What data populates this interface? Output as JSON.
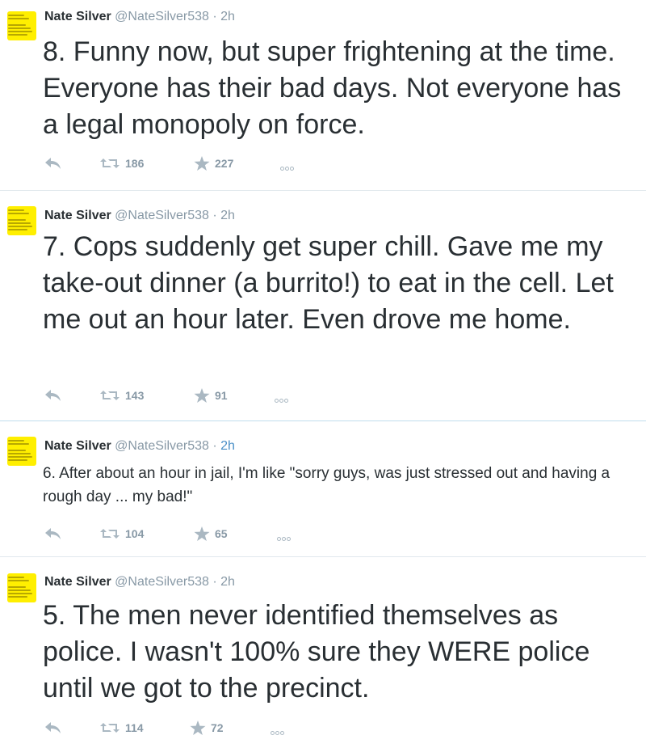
{
  "tweets": [
    {
      "name": "Nate Silver",
      "handle": "@NateSilver538",
      "sep": " · ",
      "time": "2h",
      "text": "8. Funny now, but super frightening at the time. Everyone has their bad days. Not everyone has a legal monopoly on force.",
      "retweets": "186",
      "favorites": "227"
    },
    {
      "name": "Nate Silver",
      "handle": "@NateSilver538",
      "sep": " · ",
      "time": "2h",
      "text": "7. Cops suddenly get super chill. Gave me my take-out dinner (a burrito!) to eat in the cell. Let me out an hour later. Even drove me home.",
      "retweets": "143",
      "favorites": "91"
    },
    {
      "name": "Nate Silver",
      "handle": "@NateSilver538",
      "sep": " · ",
      "time": "2h",
      "text": "6. After about an hour in jail, I'm like \"sorry guys, was just stressed out and having a rough day ... my bad!\"",
      "retweets": "104",
      "favorites": "65"
    },
    {
      "name": "Nate Silver",
      "handle": "@NateSilver538",
      "sep": " · ",
      "time": "2h",
      "text": "5. The men never identified themselves as police. I wasn't 100% sure they WERE police until we got to the precinct.",
      "retweets": "114",
      "favorites": "72"
    }
  ],
  "icons": {
    "reply": "reply-icon",
    "retweet": "retweet-icon",
    "favorite": "star-icon",
    "more": "more-icon"
  },
  "colors": {
    "text": "#292f33",
    "muted": "#8899a6",
    "link_time": "#4a8fc7",
    "avatar_bg": "#ffef00",
    "divider": "#e1e8ed",
    "divider_active": "#c0deed"
  }
}
